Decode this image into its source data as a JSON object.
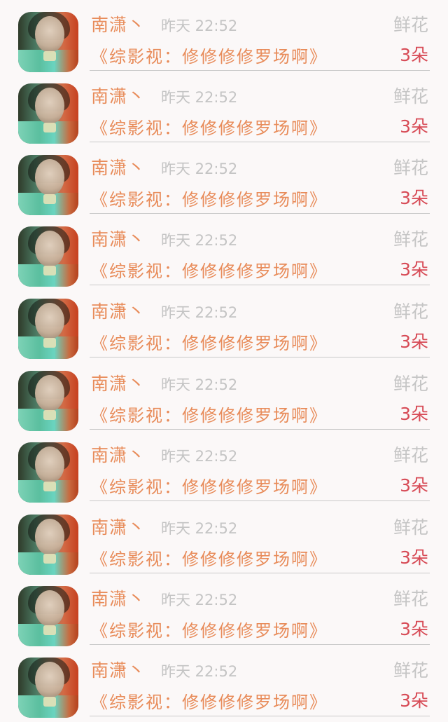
{
  "items": [
    {
      "user": "南潇丶",
      "time": "昨天 22:52",
      "gift_label": "鲜花",
      "book_title": "《综影视：修修修修罗场啊》",
      "count": "3朵"
    },
    {
      "user": "南潇丶",
      "time": "昨天 22:52",
      "gift_label": "鲜花",
      "book_title": "《综影视：修修修修罗场啊》",
      "count": "3朵"
    },
    {
      "user": "南潇丶",
      "time": "昨天 22:52",
      "gift_label": "鲜花",
      "book_title": "《综影视：修修修修罗场啊》",
      "count": "3朵"
    },
    {
      "user": "南潇丶",
      "time": "昨天 22:52",
      "gift_label": "鲜花",
      "book_title": "《综影视：修修修修罗场啊》",
      "count": "3朵"
    },
    {
      "user": "南潇丶",
      "time": "昨天 22:52",
      "gift_label": "鲜花",
      "book_title": "《综影视：修修修修罗场啊》",
      "count": "3朵"
    },
    {
      "user": "南潇丶",
      "time": "昨天 22:52",
      "gift_label": "鲜花",
      "book_title": "《综影视：修修修修罗场啊》",
      "count": "3朵"
    },
    {
      "user": "南潇丶",
      "time": "昨天 22:52",
      "gift_label": "鲜花",
      "book_title": "《综影视：修修修修罗场啊》",
      "count": "3朵"
    },
    {
      "user": "南潇丶",
      "time": "昨天 22:52",
      "gift_label": "鲜花",
      "book_title": "《综影视：修修修修罗场啊》",
      "count": "3朵"
    },
    {
      "user": "南潇丶",
      "time": "昨天 22:52",
      "gift_label": "鲜花",
      "book_title": "《综影视：修修修修罗场啊》",
      "count": "3朵"
    },
    {
      "user": "南潇丶",
      "time": "昨天 22:52",
      "gift_label": "鲜花",
      "book_title": "《综影视：修修修修罗场啊》",
      "count": "3朵"
    }
  ],
  "colors": {
    "accent_orange": "#e88b59",
    "count_red": "#d74b56",
    "muted_gray": "#c5c5c5",
    "background": "#fbf8f8"
  },
  "icons": {
    "avatar": "user-avatar-photo"
  }
}
